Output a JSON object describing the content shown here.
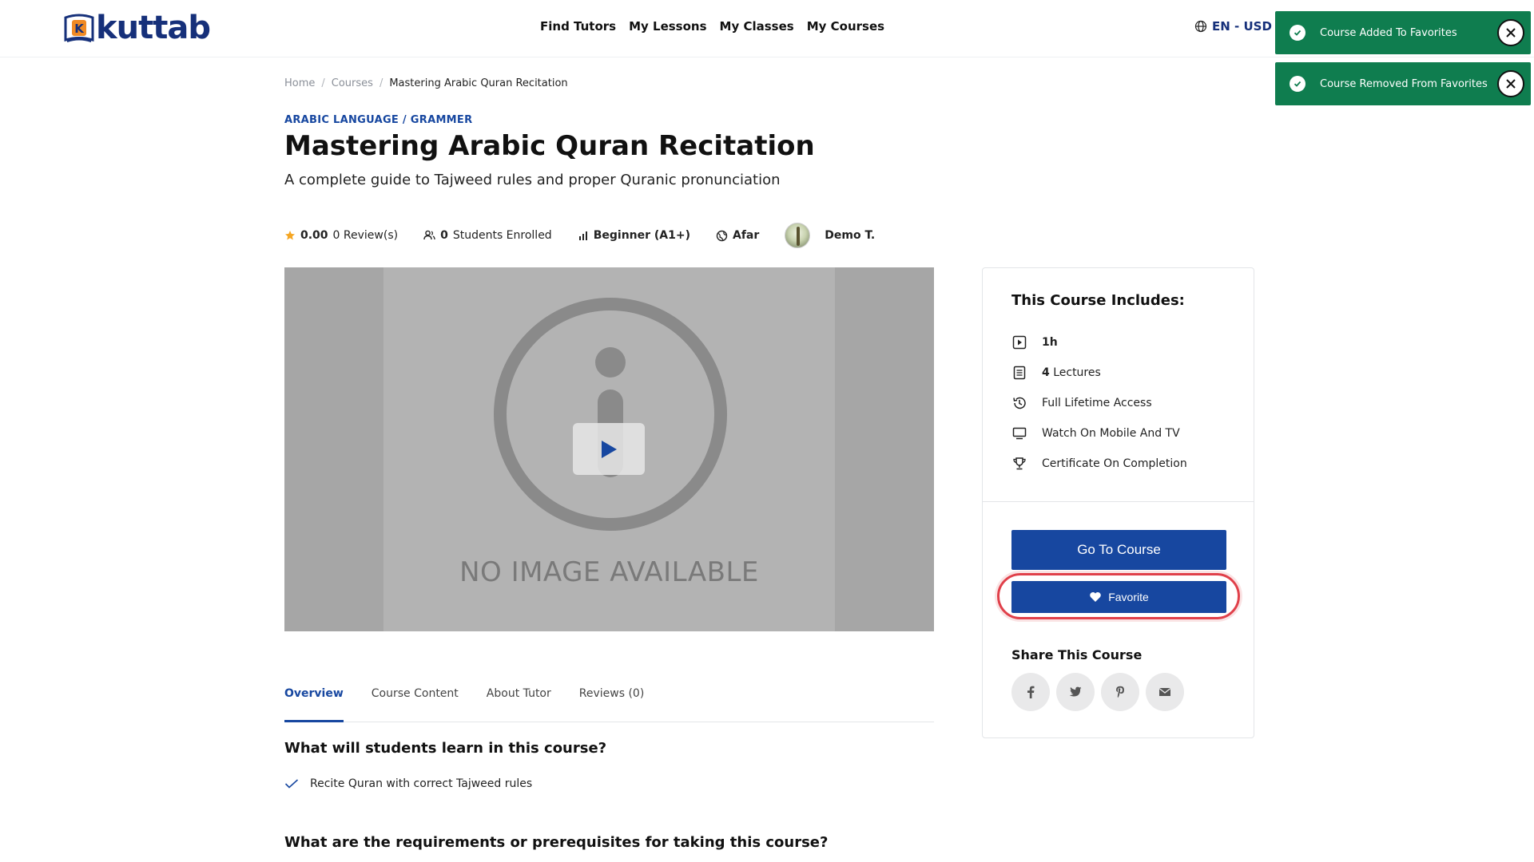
{
  "header": {
    "logo_text": "kuttab",
    "nav": [
      "Find Tutors",
      "My Lessons",
      "My Classes",
      "My Courses"
    ],
    "lang_currency": "EN - USD"
  },
  "toasts": [
    {
      "message": "Course Added To Favorites"
    },
    {
      "message": "Course Removed From Favorites"
    }
  ],
  "breadcrumb": {
    "home": "Home",
    "courses": "Courses",
    "current": "Mastering Arabic Quran Recitation",
    "sep": "/"
  },
  "course": {
    "category": "ARABIC LANGUAGE / GRAMMER",
    "title": "Mastering Arabic Quran Recitation",
    "subtitle": "A complete guide to Tajweed rules and proper Quranic pronunciation",
    "rating": "0.00",
    "reviews": "0 Review(s)",
    "students_count": "0",
    "students_label": "Students Enrolled",
    "level": "Beginner (A1+)",
    "language": "Afar",
    "tutor": "Demo T."
  },
  "video": {
    "placeholder_text": "NO IMAGE AVAILABLE"
  },
  "tabs": [
    "Overview",
    "Course Content",
    "About Tutor",
    "Reviews (0)"
  ],
  "overview": {
    "learn_heading": "What will students learn in this course?",
    "learn_items": [
      "Recite Quran with correct Tajweed rules"
    ],
    "requirements_heading": "What are the requirements or prerequisites for taking this course?"
  },
  "sidebar": {
    "includes_title": "This Course Includes:",
    "duration": "1h",
    "lectures_count": "4",
    "lectures_label": "Lectures",
    "lifetime": "Full Lifetime Access",
    "mobile": "Watch On Mobile And TV",
    "certificate": "Certificate On Completion",
    "go_button": "Go To Course",
    "favorite_button": "Favorite",
    "share_title": "Share This Course",
    "share_icons": [
      "facebook-icon",
      "twitter-icon",
      "pinterest-icon",
      "email-icon"
    ]
  },
  "colors": {
    "primary": "#1747a0",
    "toast": "#0f7d4f",
    "highlight": "#e0404a",
    "star": "#f5a623"
  }
}
